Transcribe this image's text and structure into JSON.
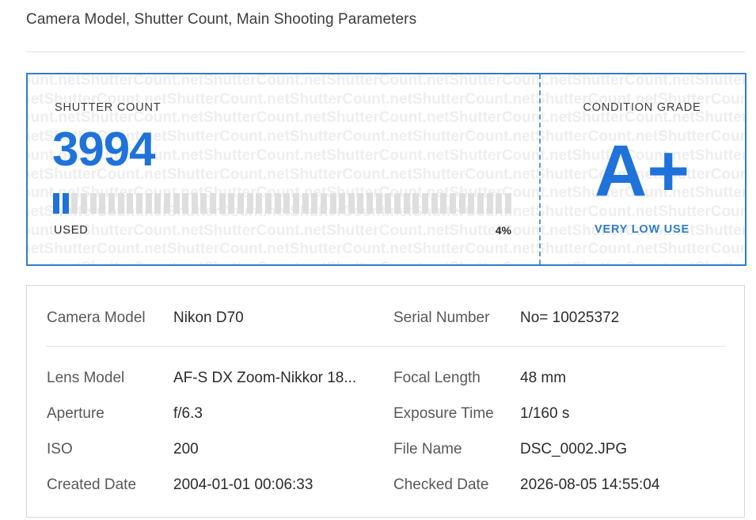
{
  "header": {
    "title": "Camera Model, Shutter Count, Main Shooting Parameters"
  },
  "shutter": {
    "label": "SHUTTER COUNT",
    "count": "3994",
    "used_label": "USED",
    "used_percent_text": "4%",
    "used_fraction": 0.04,
    "watermark": "ShutterCount.net"
  },
  "grade": {
    "label": "CONDITION GRADE",
    "value": "A+",
    "note": "VERY LOW USE"
  },
  "details": {
    "camera_model": {
      "label": "Camera Model",
      "value": "Nikon D70"
    },
    "serial_number": {
      "label": "Serial Number",
      "value": "No= 10025372"
    },
    "lens_model": {
      "label": "Lens Model",
      "value": "AF-S DX Zoom-Nikkor 18..."
    },
    "focal_length": {
      "label": "Focal Length",
      "value": "48 mm"
    },
    "aperture": {
      "label": "Aperture",
      "value": "f/6.3"
    },
    "exposure_time": {
      "label": "Exposure Time",
      "value": "1/160 s"
    },
    "iso": {
      "label": "ISO",
      "value": "200"
    },
    "file_name": {
      "label": "File Name",
      "value": "DSC_0002.JPG"
    },
    "created_date": {
      "label": "Created Date",
      "value": "2004-01-01 00:06:33"
    },
    "checked_date": {
      "label": "Checked Date",
      "value": "2026-08-05 14:55:04"
    }
  },
  "colors": {
    "accent": "#1e72d9",
    "border": "#2f7dc9",
    "bar_empty": "#dedede"
  }
}
